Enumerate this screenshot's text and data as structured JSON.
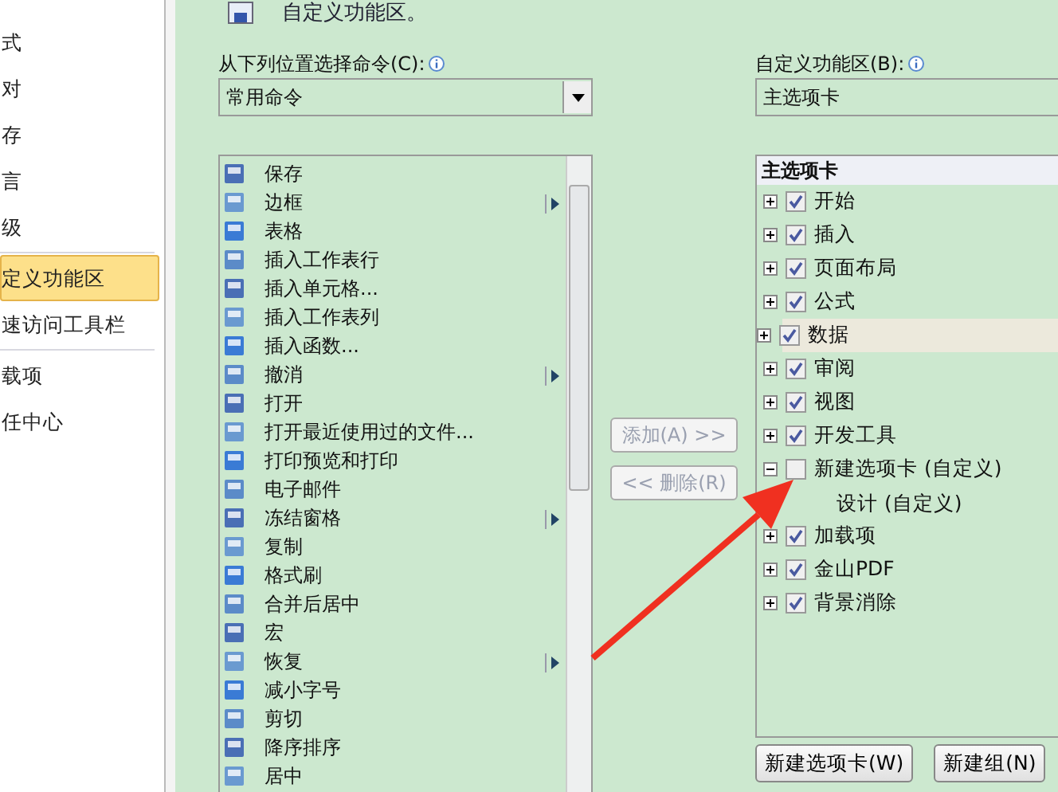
{
  "sidebar": {
    "items": [
      {
        "label": "式",
        "selected": false
      },
      {
        "label": "对",
        "selected": false
      },
      {
        "label": "存",
        "selected": false
      },
      {
        "label": "言",
        "selected": false
      },
      {
        "label": "级",
        "selected": false,
        "divider_after": true
      },
      {
        "label": "定义功能区",
        "selected": true
      },
      {
        "label": "速访问工具栏",
        "selected": false,
        "divider_after": true
      },
      {
        "label": "载项",
        "selected": false
      },
      {
        "label": "任中心",
        "selected": false
      }
    ]
  },
  "header": {
    "text": "自定义功能区。"
  },
  "commands_panel": {
    "label": "从下列位置选择命令(C):",
    "dropdown_value": "常用命令",
    "items": [
      {
        "label": "保存",
        "submenu": false
      },
      {
        "label": "边框",
        "submenu": true
      },
      {
        "label": "表格",
        "submenu": false
      },
      {
        "label": "插入工作表行",
        "submenu": false
      },
      {
        "label": "插入单元格...",
        "submenu": false
      },
      {
        "label": "插入工作表列",
        "submenu": false
      },
      {
        "label": "插入函数...",
        "submenu": false
      },
      {
        "label": "撤消",
        "submenu": true
      },
      {
        "label": "打开",
        "submenu": false
      },
      {
        "label": "打开最近使用过的文件...",
        "submenu": false
      },
      {
        "label": "打印预览和打印",
        "submenu": false
      },
      {
        "label": "电子邮件",
        "submenu": false
      },
      {
        "label": "冻结窗格",
        "submenu": true
      },
      {
        "label": "复制",
        "submenu": false
      },
      {
        "label": "格式刷",
        "submenu": false
      },
      {
        "label": "合并后居中",
        "submenu": false
      },
      {
        "label": "宏",
        "submenu": false
      },
      {
        "label": "恢复",
        "submenu": true
      },
      {
        "label": "减小字号",
        "submenu": false
      },
      {
        "label": "剪切",
        "submenu": false
      },
      {
        "label": "降序排序",
        "submenu": false
      },
      {
        "label": "居中",
        "submenu": false
      }
    ]
  },
  "middle_buttons": [
    {
      "label": "添加(A) >>",
      "disabled": true
    },
    {
      "label": "<< 删除(R)",
      "disabled": true
    }
  ],
  "ribbon_panel": {
    "label": "自定义功能区(B):",
    "dropdown_value": "主选项卡",
    "tree_header": "主选项卡",
    "tabs": [
      {
        "label": "开始",
        "checked": true,
        "expanded": false,
        "selected": false
      },
      {
        "label": "插入",
        "checked": true,
        "expanded": false,
        "selected": false
      },
      {
        "label": "页面布局",
        "checked": true,
        "expanded": false,
        "selected": false
      },
      {
        "label": "公式",
        "checked": true,
        "expanded": false,
        "selected": false
      },
      {
        "label": "数据",
        "checked": true,
        "expanded": false,
        "selected": true
      },
      {
        "label": "审阅",
        "checked": true,
        "expanded": false,
        "selected": false
      },
      {
        "label": "视图",
        "checked": true,
        "expanded": false,
        "selected": false
      },
      {
        "label": "开发工具",
        "checked": true,
        "expanded": false,
        "selected": false
      },
      {
        "label": "新建选项卡 (自定义)",
        "checked": false,
        "expanded": true,
        "selected": false,
        "children": [
          {
            "label": "设计 (自定义)"
          }
        ]
      },
      {
        "label": "加载项",
        "checked": true,
        "expanded": false,
        "selected": false
      },
      {
        "label": "金山PDF",
        "checked": true,
        "expanded": false,
        "selected": false
      },
      {
        "label": "背景消除",
        "checked": true,
        "expanded": false,
        "selected": false
      }
    ],
    "buttons": [
      "新建选项卡(W)",
      "新建组(N)"
    ]
  }
}
